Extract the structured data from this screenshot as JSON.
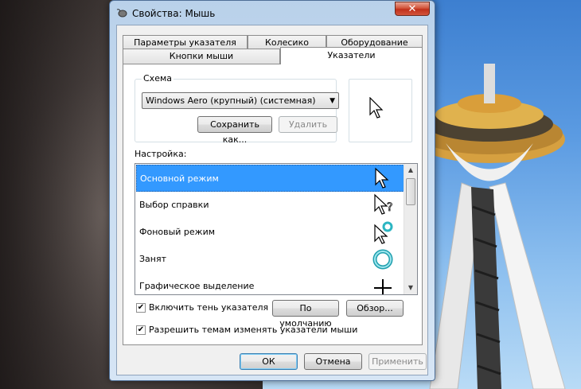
{
  "window": {
    "title": "Свойства: Мышь",
    "close_label": "✕"
  },
  "tabs": {
    "row1": [
      "Параметры указателя",
      "Колесико",
      "Оборудование"
    ],
    "row2": [
      "Кнопки мыши",
      "Указатели"
    ],
    "active": "Указатели"
  },
  "scheme": {
    "group_label": "Схема",
    "selected": "Windows Aero (крупный) (системная)",
    "save_label": "Сохранить как...",
    "delete_label": "Удалить"
  },
  "setup": {
    "label": "Настройка:",
    "items": [
      {
        "label": "Основной режим",
        "icon": "arrow-cursor-icon",
        "selected": true
      },
      {
        "label": "Выбор справки",
        "icon": "help-cursor-icon",
        "selected": false
      },
      {
        "label": "Фоновый режим",
        "icon": "working-in-background-cursor-icon",
        "selected": false
      },
      {
        "label": "Занят",
        "icon": "busy-cursor-icon",
        "selected": false
      },
      {
        "label": "Графическое выделение",
        "icon": "precision-select-cursor-icon",
        "selected": false
      }
    ]
  },
  "options": {
    "shadow_label": "Включить тень указателя",
    "shadow_checked": true,
    "themes_label": "Разрешить темам изменять указатели мыши",
    "themes_checked": true,
    "default_label": "По умолчанию",
    "browse_label": "Обзор..."
  },
  "footer": {
    "ok_label": "ОК",
    "cancel_label": "Отмена",
    "apply_label": "Применить"
  },
  "colors": {
    "selection": "#3399ff",
    "busy_ring": "#2bb5c2"
  }
}
